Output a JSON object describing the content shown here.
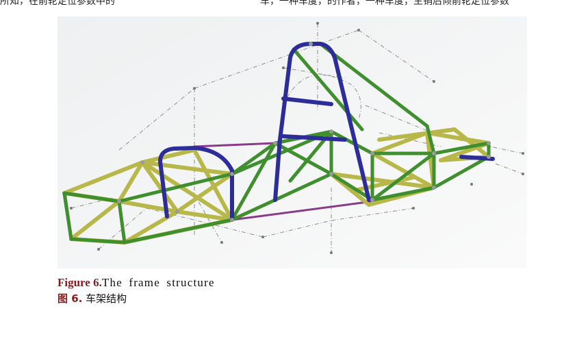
{
  "top_text": {
    "left": "所知，在前轮定位参数中的",
    "right": "车，一种车度，的作者，一种车度，主销后倾前轮定位参数"
  },
  "figure": {
    "caption_label": "Figure 6.",
    "caption_text": "The frame structure",
    "caption_cn_label": "图 6.",
    "caption_cn_text": "车架结构",
    "colors": {
      "background": "#f2f3f3",
      "frame_green": "#3f8f2f",
      "brace_yellow": "#b8b84a",
      "hoop_blue": "#2d2d9a",
      "member_purple": "#8a3a8a",
      "dimension_line": "#8c8c8c"
    }
  }
}
